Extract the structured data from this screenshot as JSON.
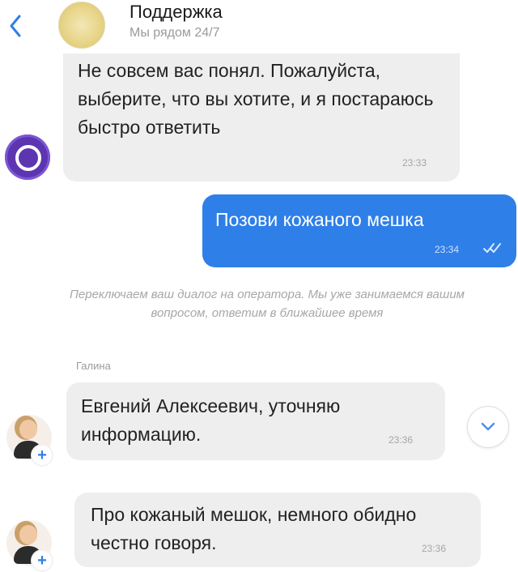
{
  "header": {
    "title": "Поддержка",
    "subtitle": "Мы рядом 24/7",
    "back_icon": "chevron-left-icon"
  },
  "messages": {
    "bot": {
      "text": "Не совсем вас понял. Пожалуйста, выберите, что вы хотите, и я постараюсь быстро ответить",
      "time": "23:33"
    },
    "user": {
      "text": "Позови кожаного мешка",
      "time": "23:34",
      "status_icon": "double-check-icon"
    },
    "system": {
      "text": "Переключаем ваш диалог на оператора. Мы уже занимаемся вашим вопросом, ответим в ближайшее время"
    },
    "operator": {
      "name": "Галина",
      "messages": [
        {
          "text": "Евгений Алексеевич, уточняю информацию.",
          "time": "23:36"
        },
        {
          "text": "Про кожаный мешок, немного обидно честно говоря.",
          "time": "23:36"
        }
      ]
    }
  },
  "colors": {
    "outgoing_bubble": "#2f7fe8",
    "incoming_bubble": "#eeeeee",
    "bot_avatar": "#5e35b1"
  }
}
